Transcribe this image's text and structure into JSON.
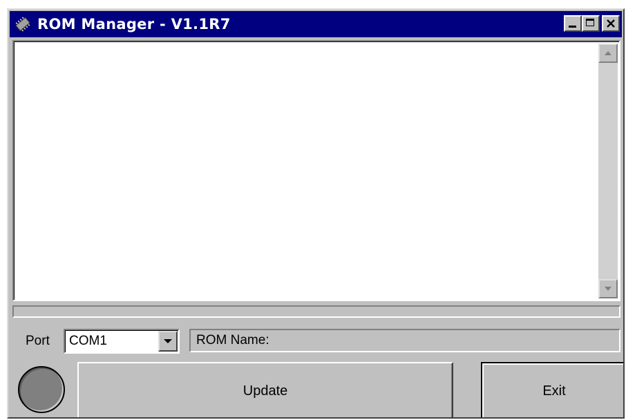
{
  "window": {
    "title": "ROM Manager - V1.1R7",
    "icon": "chip-icon",
    "buttons": [
      "minimize-icon",
      "maximize-icon",
      "close-icon"
    ]
  },
  "log": {
    "text": ""
  },
  "progress": {
    "fraction": 0
  },
  "port": {
    "label": "Port",
    "selected": "COM1"
  },
  "rom_name": {
    "label": "ROM Name:"
  },
  "status_light": {
    "color": "#808080"
  },
  "actions": {
    "update_label": "Update",
    "exit_label": "Exit"
  },
  "colors": {
    "titlebar": "#000080",
    "face": "#c0c0c0"
  }
}
